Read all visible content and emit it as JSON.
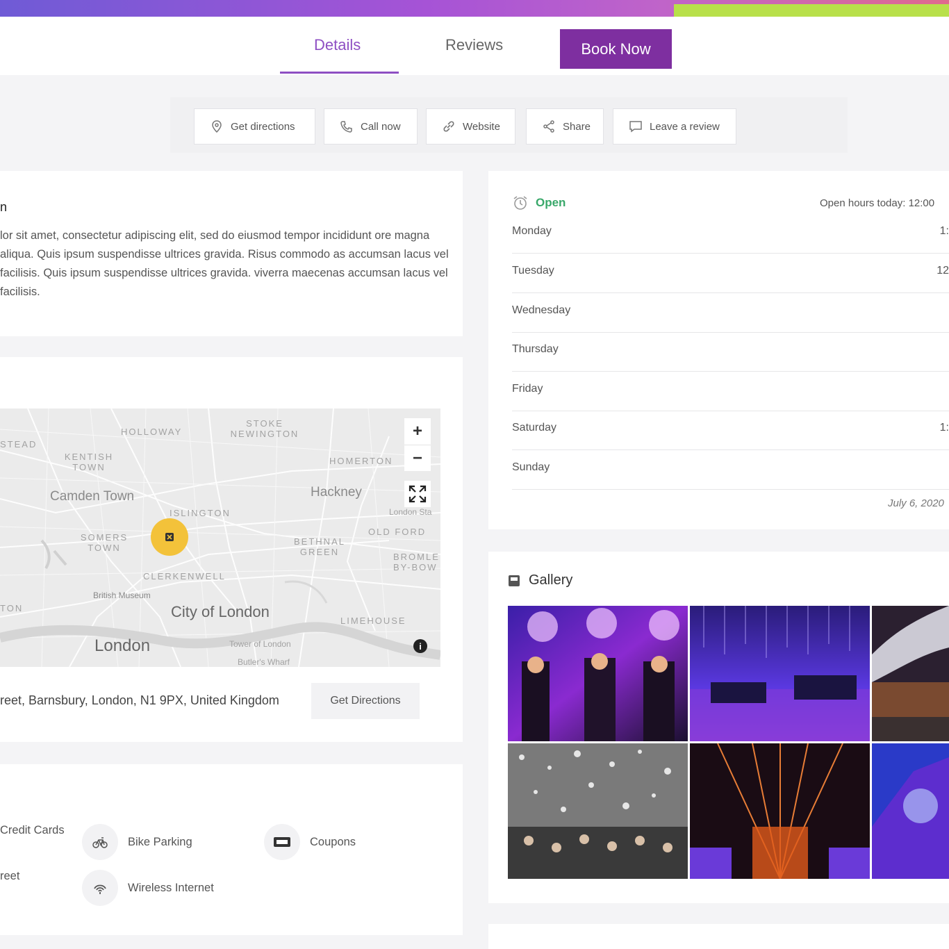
{
  "tabs": {
    "details": "Details",
    "reviews": "Reviews",
    "book_now": "Book Now"
  },
  "actions": [
    {
      "label": "Get directions",
      "icon": "map-pin-icon"
    },
    {
      "label": "Call now",
      "icon": "phone-icon"
    },
    {
      "label": "Website",
      "icon": "link-icon"
    },
    {
      "label": "Share",
      "icon": "share-icon"
    },
    {
      "label": "Leave a review",
      "icon": "comment-icon"
    }
  ],
  "description": {
    "title": "n",
    "text": "lor sit amet, consectetur adipiscing elit, sed do eiusmod tempor incididunt ore magna aliqua. Quis ipsum suspendisse ultrices gravida. Risus commodo as accumsan lacus vel facilisis. Quis ipsum suspendisse ultrices gravida. viverra maecenas accumsan lacus vel facilisis."
  },
  "map": {
    "labels": [
      "HOLLOWAY",
      "STOKE NEWINGTON",
      "STEAD",
      "KENTISH TOWN",
      "HOMERTON",
      "Camden Town",
      "Hackney",
      "ISLINGTON",
      "London Sta",
      "SOMERS TOWN",
      "BETHNAL GREEN",
      "OLD FORD",
      "BROMLE BY-BOW",
      "CLERKENWELL",
      "British Museum",
      "TON",
      "City of London",
      "LIMEHOUSE",
      "London",
      "Tower of London",
      "Butler's Wharf"
    ],
    "zoom_in": "+",
    "zoom_out": "−",
    "info": "i"
  },
  "address": {
    "text": "reet, Barnsbury, London, N1 9PX, United Kingdom",
    "button": "Get Directions"
  },
  "amenities": [
    {
      "label": "Credit Cards",
      "icon": "credit-card-icon"
    },
    {
      "label": "Bike Parking",
      "icon": "bike-icon"
    },
    {
      "label": "Coupons",
      "icon": "coupon-icon"
    },
    {
      "label": "reet",
      "icon": "street-icon"
    },
    {
      "label": "Wireless Internet",
      "icon": "wifi-icon"
    }
  ],
  "hours": {
    "status": "Open",
    "today": "Open hours today: 12:00 ",
    "days": [
      {
        "day": "Monday",
        "time": "1:"
      },
      {
        "day": "Tuesday",
        "time": "12"
      },
      {
        "day": "Wednesday",
        "time": ""
      },
      {
        "day": "Thursday",
        "time": ""
      },
      {
        "day": "Friday",
        "time": ""
      },
      {
        "day": "Saturday",
        "time": "1:"
      },
      {
        "day": "Sunday",
        "time": ""
      }
    ],
    "updated": "July 6, 2020"
  },
  "gallery": {
    "title": "Gallery"
  },
  "colors": {
    "accent": "#8e4fc3",
    "book_button": "#7e2fa0",
    "open_green": "#39a86a",
    "pin_yellow": "#f3c23a"
  }
}
